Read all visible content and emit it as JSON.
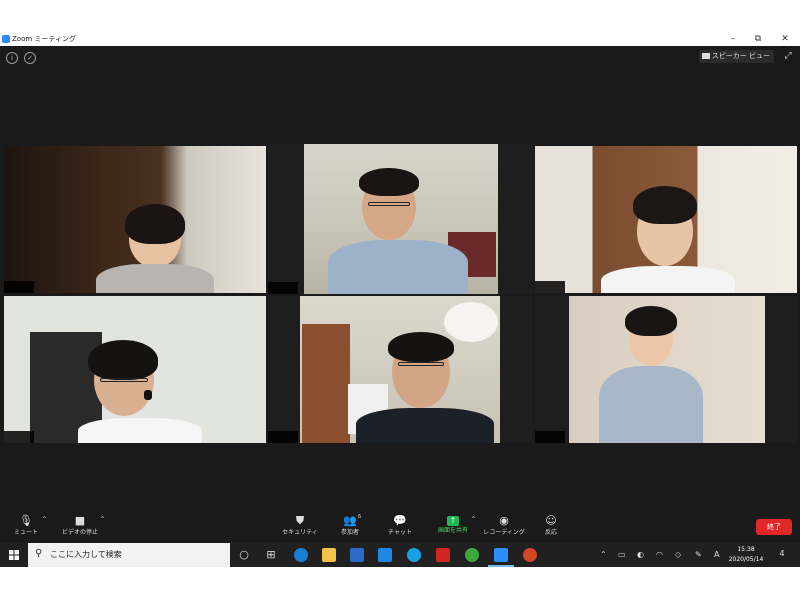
{
  "window": {
    "title": "Zoom ミーティング",
    "controls": {
      "minimize": "–",
      "restore": "⧉",
      "close": "✕"
    }
  },
  "meeting": {
    "info_icon": "i",
    "security_icon": "✓",
    "speaker_view_label": "スピーカー ビュー",
    "fullscreen_icon": "⤢"
  },
  "toolbar": {
    "mute_label": "ミュート",
    "video_label": "ビデオの停止",
    "security_label": "セキュリティ",
    "participants_label": "参加者",
    "participants_count": "6",
    "chat_label": "チャット",
    "share_label": "画面を共有",
    "record_label": "レコーディング",
    "reactions_label": "反応",
    "end_label": "終了",
    "caret": "^"
  },
  "taskbar": {
    "search_placeholder": "ここに入力して検索",
    "ime_label": "A",
    "time": "15:38",
    "date": "2020/05/14",
    "notification_count": "4"
  },
  "colors": {
    "meeting_bg": "#1a1a1a",
    "active_speaker_border": "#d4e157",
    "end_button": "#e02828",
    "share_green": "#1db954"
  }
}
